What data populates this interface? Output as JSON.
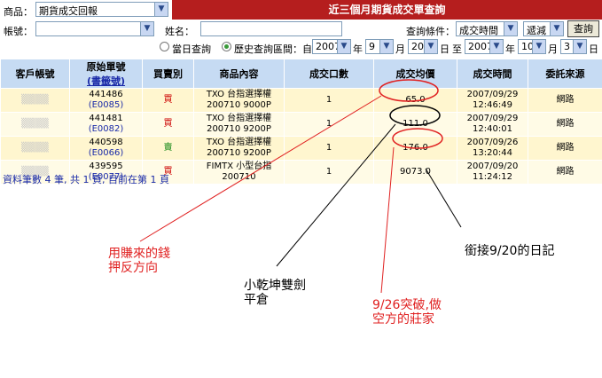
{
  "header": {
    "product_label": "商品：",
    "product_value": "期貨成交回報",
    "title": "近三個月期貨成交單查詢"
  },
  "filters": {
    "account_label": "帳號：",
    "name_label": "姓名：",
    "condition_label": "查詢條件：",
    "condition_value": "成交時間",
    "order_value": "遞減",
    "query_button": "查詢",
    "today_label": "當日查詢",
    "history_label": "歷史查詢區間：自",
    "from_year": "2007",
    "from_month": "9",
    "from_day": "20",
    "to_year": "2007",
    "to_month": "10",
    "to_day": "3",
    "year_unit": "年",
    "month_unit": "月",
    "day_unit": "日",
    "to_label": "至"
  },
  "table": {
    "headers": [
      "客戶帳號",
      "原始單號",
      "買賣別",
      "商品內容",
      "成交口數",
      "成交均價",
      "成交時間",
      "委託來源"
    ],
    "header_sub": "(書籤號)",
    "rows": [
      {
        "order": "441486",
        "sub": "(E0085)",
        "side": "買",
        "product": "TXO 台指選擇權",
        "product2": "200710 9000P",
        "qty": "1",
        "price": "65.0",
        "date": "2007/09/29",
        "time": "12:46:49",
        "source": "網路"
      },
      {
        "order": "441481",
        "sub": "(E0082)",
        "side": "買",
        "product": "TXO 台指選擇權",
        "product2": "200710 9200P",
        "qty": "1",
        "price": "111.0",
        "date": "2007/09/29",
        "time": "12:40:01",
        "source": "網路"
      },
      {
        "order": "440598",
        "sub": "(E0066)",
        "side": "賣",
        "product": "TXO 台指選擇權",
        "product2": "200710 9200P",
        "qty": "1",
        "price": "176.0",
        "date": "2007/09/26",
        "time": "13:20:44",
        "source": "網路"
      },
      {
        "order": "439595",
        "sub": "(E0077)",
        "side": "買",
        "product": "FIMTX 小型台指",
        "product2": "200710",
        "qty": "1",
        "price": "9073.0",
        "date": "2007/09/20",
        "time": "11:24:12",
        "source": "網路"
      }
    ]
  },
  "footer": "資料筆數 4 筆, 共 1 頁, 目前在第 1 頁",
  "annotations": {
    "note1_l1": "用賺來的錢",
    "note1_l2": "押反方向",
    "note2_l1": "小乾坤雙劍",
    "note2_l2": "平倉",
    "note3_l1": "9/26突破,做",
    "note3_l2": "空方的莊家",
    "note4": "銜接9/20的日記"
  },
  "colors": {
    "title_bar": "#b51e1e",
    "header_bg": "#c6dbf3",
    "row_bg": "#fff6cf",
    "annotation_red": "#e02020"
  }
}
